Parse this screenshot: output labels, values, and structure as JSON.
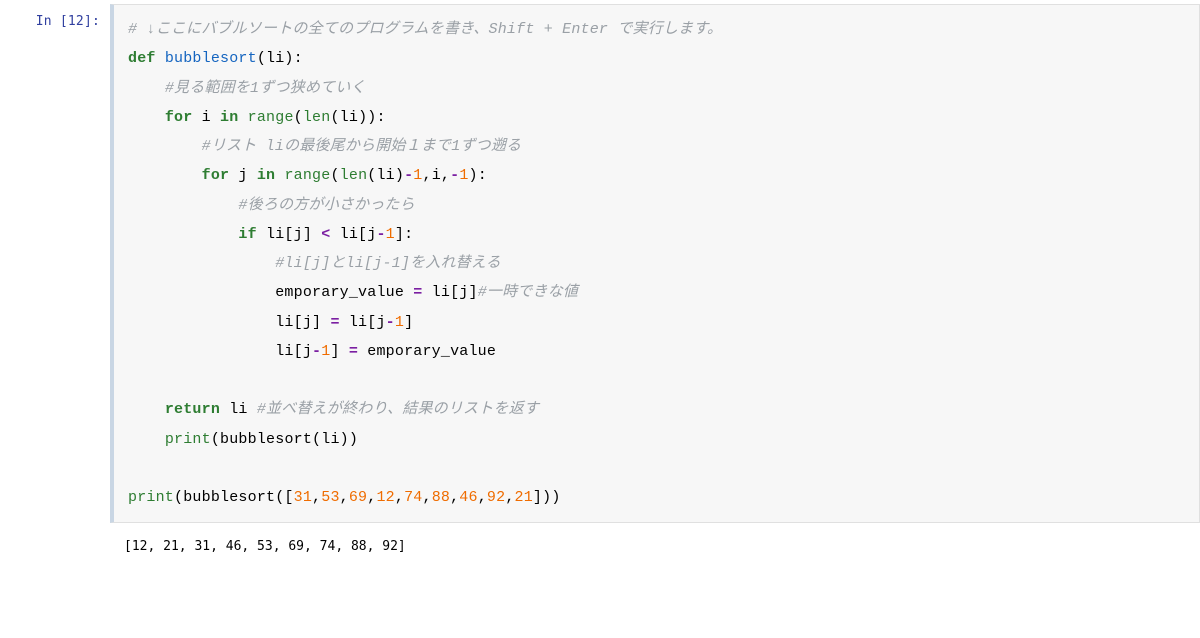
{
  "cell": {
    "prompt": "In [12]:",
    "code": {
      "line1_comment": "# ↓ここにバブルソートの全てのプログラムを書き、Shift + Enter で実行します。",
      "kw_def": "def",
      "fn_name": "bubblesort",
      "param": "(li):",
      "comment_scope": "#見る範囲を1ずつ狭めていく",
      "kw_for": "for",
      "loop_i_var": " i ",
      "kw_in": "in",
      "fn_range": " range",
      "fn_len": "len",
      "open_paren": "(",
      "close_paren": ")",
      "li_ident": "li",
      "loop_i_close": ":",
      "comment_tail": "#リスト liの最後尾から開始１まで1ずつ遡る",
      "loop_j_var": " j ",
      "neg1": "-1",
      "comma": ",",
      "i_ident": "i",
      "comment_small": "#後ろの方が小さかったら",
      "kw_if": "if",
      "li_sub_j": " li[j] ",
      "op_lt": "<",
      "li_sub_jm1": " li[j",
      "close_br": "]:",
      "comment_swap": "#li[j]とli[j-1]を入れ替える",
      "temp_assign_lhs": "emporary_value ",
      "op_eq": "=",
      "temp_assign_rhs": " li[j]",
      "comment_temp": "#一時できな値",
      "assign2_lhs": "li[j] ",
      "assign2_rhs": " li[j",
      "close_br2": "]",
      "assign3_lhs": "li[j",
      "assign3_rhs": " emporary_value",
      "kw_return": "return",
      "ret_expr": " li ",
      "comment_return": "#並べ替えが終わり、結果のリストを返す",
      "print_inner": "print",
      "inner_call": "(bubblesort(li))",
      "outer_print": "print",
      "outer_open": "(bubblesort([",
      "nums": [
        "31",
        "53",
        "69",
        "12",
        "74",
        "88",
        "46",
        "92",
        "21"
      ],
      "outer_close": "]))"
    },
    "output": "[12, 21, 31, 46, 53, 69, 74, 88, 92]"
  }
}
